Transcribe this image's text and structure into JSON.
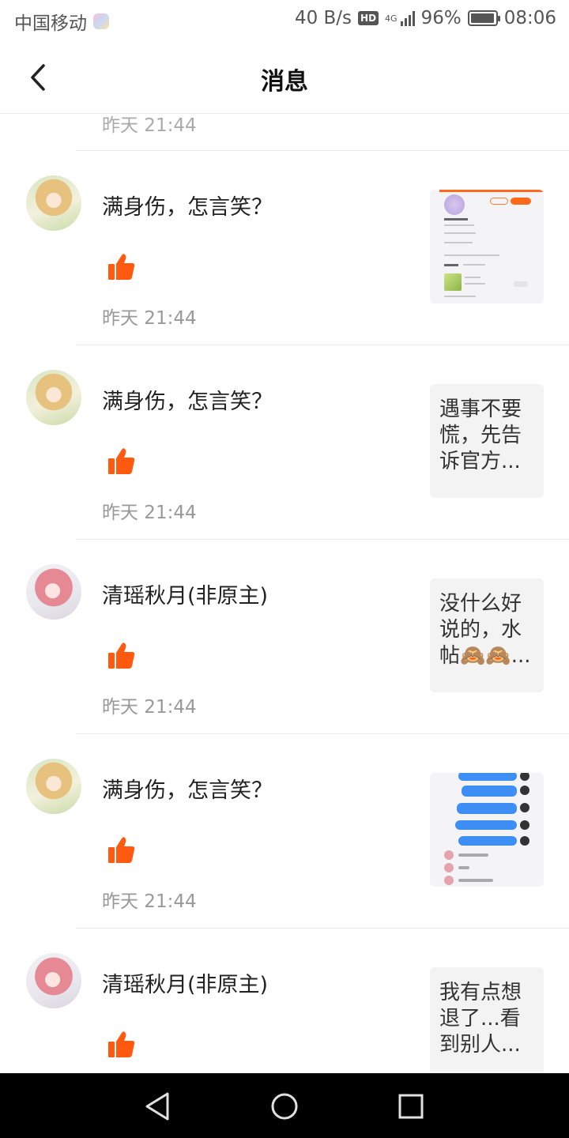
{
  "status_bar": {
    "carrier": "中国移动",
    "speed": "40 B/s",
    "hd": "HD",
    "network": "4G",
    "battery_percent": "96%",
    "battery_level": 0.96,
    "time": "08:06"
  },
  "header": {
    "title": "消息"
  },
  "list": {
    "previous_item_time": "昨天 21:44",
    "items": [
      {
        "user_name": "满身伤，怎言笑？",
        "avatar": "blonde-girl-avatar",
        "like_icon": "thumbs-up-icon",
        "time": "昨天 21:44",
        "preview_type": "image",
        "preview_image": "profile-screenshot-thumbnail",
        "preview_labels": [
          "BT.椰柔。",
          "已关注",
          "已加好友",
          "542",
          "109",
          "614",
          "最近在玩",
          "迷你世界",
          "查看"
        ]
      },
      {
        "user_name": "满身伤，怎言笑？",
        "avatar": "blonde-girl-avatar",
        "like_icon": "thumbs-up-icon",
        "time": "昨天 21:44",
        "preview_type": "text",
        "preview_text": "遇事不要慌，先告诉官方..."
      },
      {
        "user_name": "清瑶秋月(非原主)",
        "avatar": "pink-hair-girl-avatar",
        "like_icon": "thumbs-up-icon",
        "time": "昨天 21:44",
        "preview_type": "text",
        "preview_text": "没什么好说的，水帖🙈🙈..."
      },
      {
        "user_name": "满身伤，怎言笑？",
        "avatar": "blonde-girl-avatar",
        "like_icon": "thumbs-up-icon",
        "time": "昨天 21:44",
        "preview_type": "image",
        "preview_image": "chat-screenshot-thumbnail"
      },
      {
        "user_name": "清瑶秋月(非原主)",
        "avatar": "pink-hair-girl-avatar",
        "like_icon": "thumbs-up-icon",
        "time": "",
        "preview_type": "text",
        "preview_text": "我有点想退了...看到别人..."
      }
    ]
  },
  "nav_bar": {
    "back": "triangle-back-icon",
    "home": "circle-home-icon",
    "recents": "square-recents-icon"
  },
  "colors": {
    "accent": "#ff5a0f",
    "divider": "#ececec",
    "secondary_text": "#999999"
  }
}
